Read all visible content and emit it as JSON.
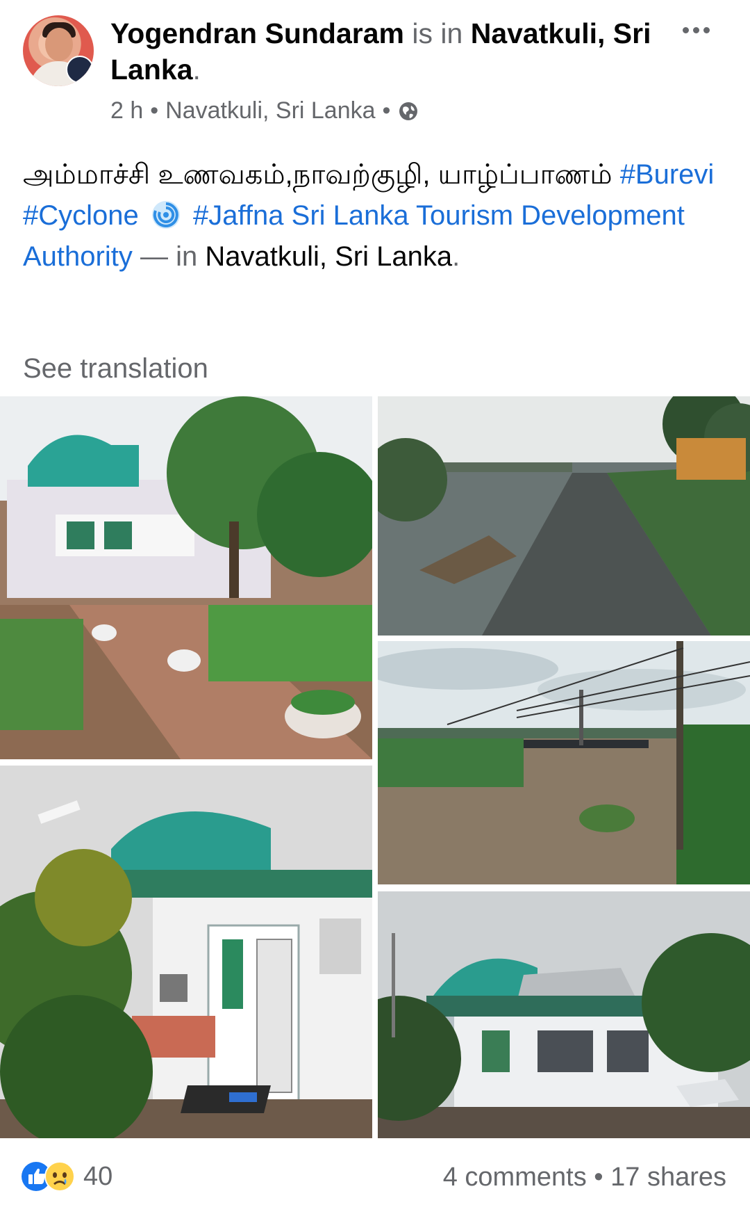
{
  "post": {
    "author": "Yogendran Sundaram",
    "is_in": "is in",
    "location_name": "Navatkuli, Sri Lanka",
    "period": ".",
    "time": "2 h",
    "dot": "•",
    "location": "Navatkuli, Sri Lanka",
    "privacy_icon": "globe-icon",
    "more_icon": "more-options-icon"
  },
  "text": {
    "tamil": "அம்மாச்சி உணவகம்,நாவற்குழி, யாழ்ப்பாணம்",
    "tag_burevi": "#Burevi",
    "tag_cyclone": "#Cyclone",
    "cyclone_emoji_icon": "cyclone-icon",
    "tag_jaffna": "#Jaffna",
    "page_link": "Sri Lanka Tourism Development Authority",
    "dash_in": "— in",
    "place": "Navatkuli, Sri Lanka",
    "end_period": "."
  },
  "see_translation": "See translation",
  "photos": [
    {
      "subject": "restaurant building with garden pots and paved path"
    },
    {
      "subject": "flooded road beside water with palm trees"
    },
    {
      "subject": "flooded field with power lines"
    },
    {
      "subject": "close view of building with curved green roof"
    },
    {
      "subject": "building with damaged roof under cloudy sky"
    }
  ],
  "footer": {
    "reaction_icons": [
      "like-icon",
      "sad-icon"
    ],
    "reaction_count": "40",
    "comments_shares": "4 comments • 17 shares"
  }
}
